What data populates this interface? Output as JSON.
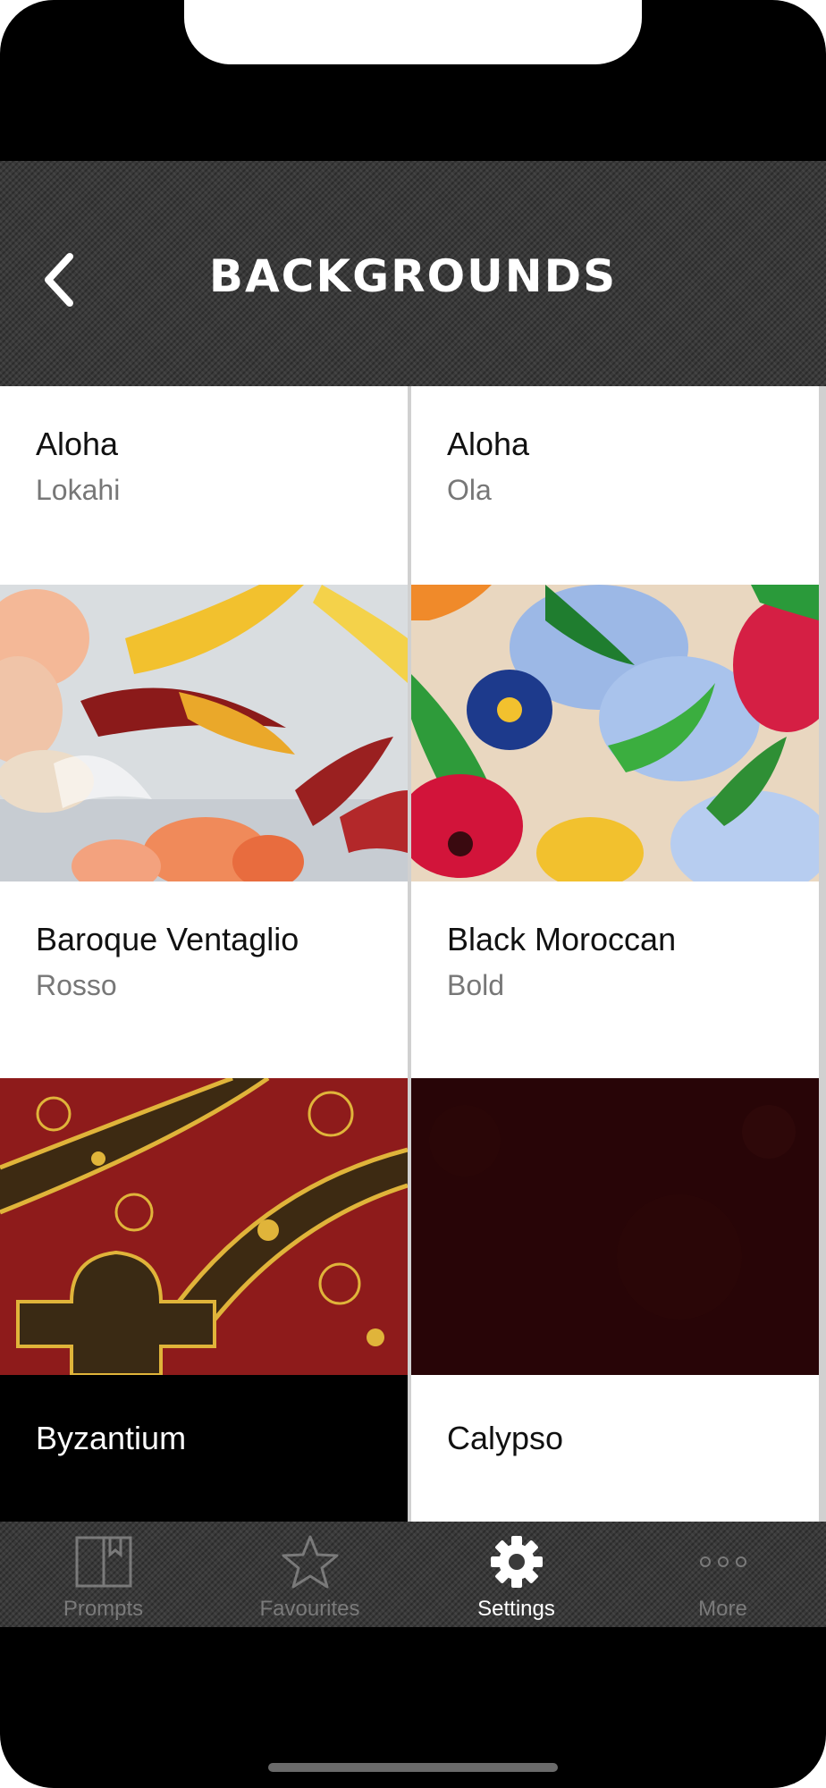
{
  "header": {
    "title": "BACKGROUNDS",
    "back_icon": "chevron-left-icon"
  },
  "tiles": [
    {
      "name": "Aloha",
      "subtitle": "Lokahi"
    },
    {
      "name": "Aloha",
      "subtitle": "Ola"
    },
    {
      "name": "Baroque Ventaglio",
      "subtitle": "Rosso"
    },
    {
      "name": "Black Moroccan",
      "subtitle": "Bold"
    },
    {
      "name": "Byzantium",
      "subtitle": ""
    },
    {
      "name": "Calypso",
      "subtitle": ""
    }
  ],
  "tab_bar": {
    "tabs": [
      {
        "label": "Prompts",
        "icon": "book-icon",
        "active": false
      },
      {
        "label": "Favourites",
        "icon": "star-icon",
        "active": false
      },
      {
        "label": "Settings",
        "icon": "gear-icon",
        "active": true
      },
      {
        "label": "More",
        "icon": "more-dots-icon",
        "active": false
      }
    ]
  },
  "colors": {
    "bar_background": "#3a3a3a",
    "active_tab": "#ffffff",
    "inactive_tab": "#7a7a7a",
    "tile_background": "#ffffff",
    "selected_dark_tile": "#000000"
  }
}
